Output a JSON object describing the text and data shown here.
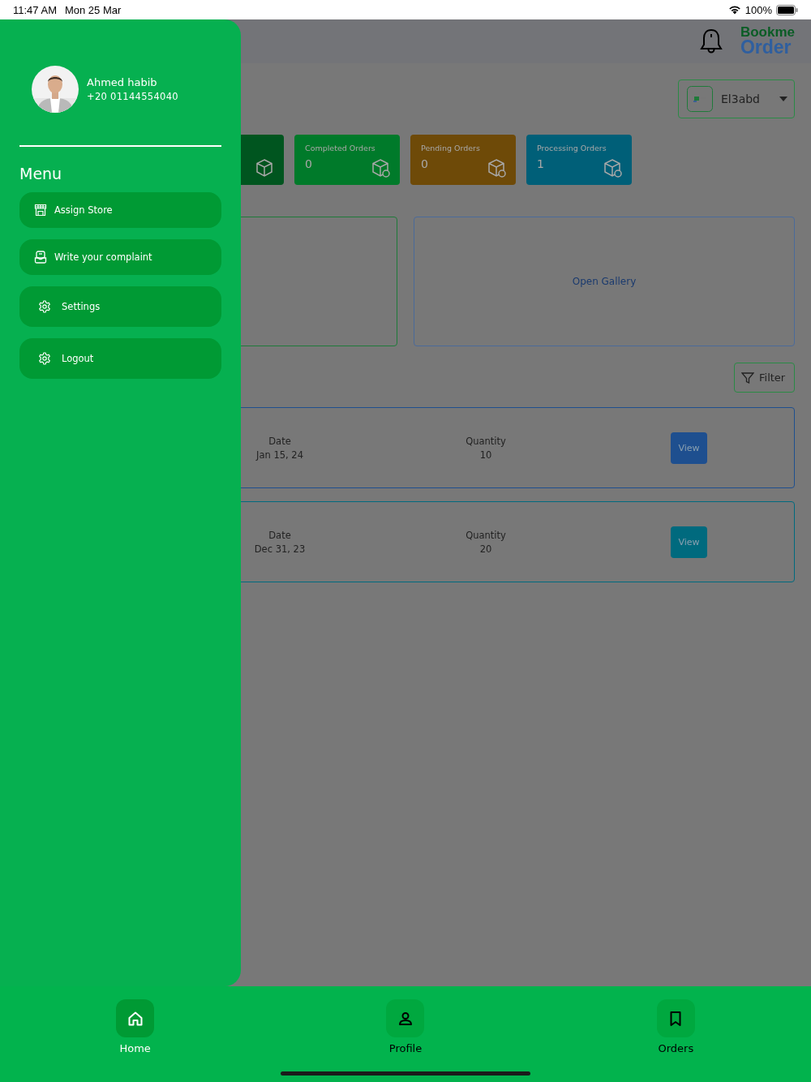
{
  "status_bar": {
    "time": "11:47 AM",
    "date": "Mon 25 Mar",
    "battery": "100%"
  },
  "header": {
    "logo_top": "Bookme",
    "logo_bottom": "Order"
  },
  "store_selector": {
    "value": "El3abd"
  },
  "stat_cards": [
    {
      "color": "#00551f"
    },
    {
      "label": "Completed Orders",
      "count": "0",
      "color": "#007a2a"
    },
    {
      "label": "Pending Orders",
      "count": "0",
      "color": "#6e4a08"
    },
    {
      "label": "Processing Orders",
      "count": "1",
      "color": "#005f78"
    }
  ],
  "gallery": {
    "label": "Open Gallery"
  },
  "filter_button": {
    "label": "Filter"
  },
  "orders": [
    {
      "date_label": "Date",
      "date": "Jan 15, 24",
      "quantity_label": "Quantity",
      "quantity": "10",
      "button": "View",
      "color": "#1e4f8f"
    },
    {
      "date_label": "Date",
      "date": "Dec 31, 23",
      "quantity_label": "Quantity",
      "quantity": "20",
      "button": "View",
      "color": "#006a7e"
    }
  ],
  "drawer": {
    "user_name": "Ahmed habib",
    "phone": "+20 01144554040",
    "menu_title": "Menu",
    "items": [
      {
        "label": "Assign Store",
        "kind": "store"
      },
      {
        "label": "Write your complaint",
        "kind": "complaint"
      },
      {
        "label": "Settings",
        "kind": "settings"
      },
      {
        "label": "Logout",
        "kind": "logout"
      }
    ]
  },
  "bottom_nav": [
    {
      "label": "Home",
      "kind": "home",
      "selected": true
    },
    {
      "label": "Profile",
      "kind": "profile",
      "selected": false
    },
    {
      "label": "Orders",
      "kind": "orders",
      "selected": false
    }
  ]
}
